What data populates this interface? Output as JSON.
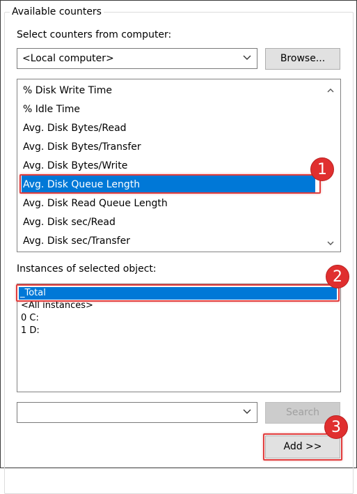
{
  "group_title": "Available counters",
  "computer_label": "Select counters from computer:",
  "computer_value": "<Local computer>",
  "browse_label": "Browse...",
  "counters": [
    "% Disk Write Time",
    "% Idle Time",
    "Avg. Disk Bytes/Read",
    "Avg. Disk Bytes/Transfer",
    "Avg. Disk Bytes/Write",
    "Avg. Disk Queue Length",
    "Avg. Disk Read Queue Length",
    "Avg. Disk sec/Read",
    "Avg. Disk sec/Transfer"
  ],
  "selected_counter": "Avg. Disk Queue Length",
  "instances_label": "Instances of selected object:",
  "instances": [
    "_Total",
    "<All instances>",
    "0 C:",
    "1 D:"
  ],
  "selected_instance": "_Total",
  "search_value": "",
  "search_label": "Search",
  "add_label": "Add >>",
  "callouts": [
    "1",
    "2",
    "3"
  ],
  "colors": {
    "selection": "#0078d7",
    "callout": "#e02f2f",
    "highlight_border": "#e03c3c"
  },
  "icons": {
    "dropdown": "chevron-down-icon",
    "scroll_up": "chevron-up-icon",
    "scroll_down": "chevron-down-icon"
  }
}
